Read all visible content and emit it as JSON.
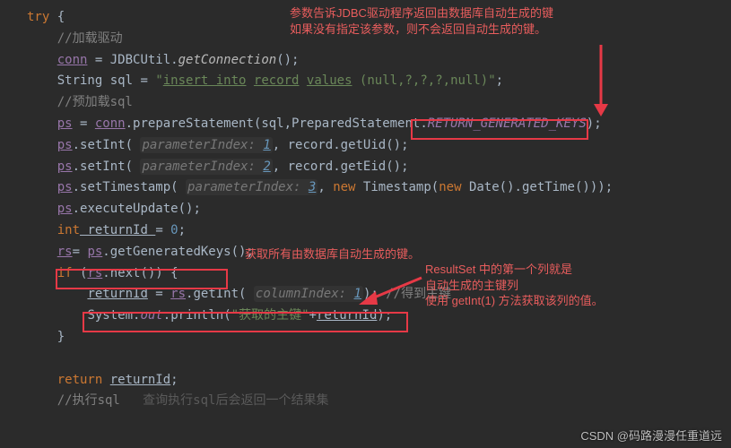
{
  "code": {
    "try": "try",
    "brace_open": " {",
    "cmt_load": "//加载驱动",
    "conn": "conn",
    "eq": " = ",
    "jdbcutil": "JDBCUtil",
    "dot": ".",
    "getconn": "getConnection",
    "paren_end": "();",
    "string_kw": "String",
    "sql_var": " sql = ",
    "sql_str1": "\"",
    "sql_str2": "insert into",
    "sql_str3": " ",
    "sql_str4": "record",
    "sql_str5": " ",
    "sql_str6": "values",
    "sql_str7": " (null,?,?,?,null)",
    "sql_str8": "\"",
    "semi": ";",
    "cmt_preload": "//预加载sql",
    "ps": "ps",
    "prepare": "prepareStatement",
    "sql_arg": "(sql,",
    "pstmt": "PreparedStatement",
    "ret_keys": "RETURN_GENERATED_KEYS",
    "close_p": ");",
    "setint": "setInt",
    "open_p": "( ",
    "pidx": "parameterIndex:",
    "one": "1",
    "two": "2",
    "three": "3",
    "comma_sp": ", ",
    "record": "record",
    "getuid": "getUid",
    "geteid": "getEid",
    "setts": "setTimestamp",
    "new_kw": "new",
    "ts_cls": " Timestamp(",
    "date_cls": " Date()",
    "gettime": "getTime",
    "close_pp": "()));",
    "exec": "executeUpdate",
    "int_kw": "int",
    "returnid": " returnId ",
    "returnid_nosp": "returnId",
    "zero": "0",
    "rs": "rs",
    "eq2": "= ",
    "ggk": "getGeneratedKeys",
    "if_kw": "if",
    "next": "next",
    "open_br": "()) {",
    "getint": "getInt",
    "cidx": "columnIndex:",
    "cmt_pk": "//得到主键",
    "system": "System",
    "out": "out",
    "println": "println",
    "got_pk": "\"获取的主键\"",
    "plus": "+",
    "close_br": "}",
    "return_kw": "return",
    "cmt_exec": "//执行sql",
    "cmt_result": "查询执行sql后会返回一个结果集"
  },
  "annotations": {
    "a1_l1": "参数告诉JDBC驱动程序返回由数据库自动生成的键",
    "a1_l2": "如果没有指定该参数，则不会返回自动生成的键。",
    "a2": "获取所有由数据库自动生成的键。",
    "a3_l1": "ResultSet 中的第一个列就是",
    "a3_l2": "自动生成的主键列",
    "a3_l3": "使用 getInt(1) 方法获取该列的值。"
  },
  "watermark": "CSDN @码路漫漫任重道远"
}
